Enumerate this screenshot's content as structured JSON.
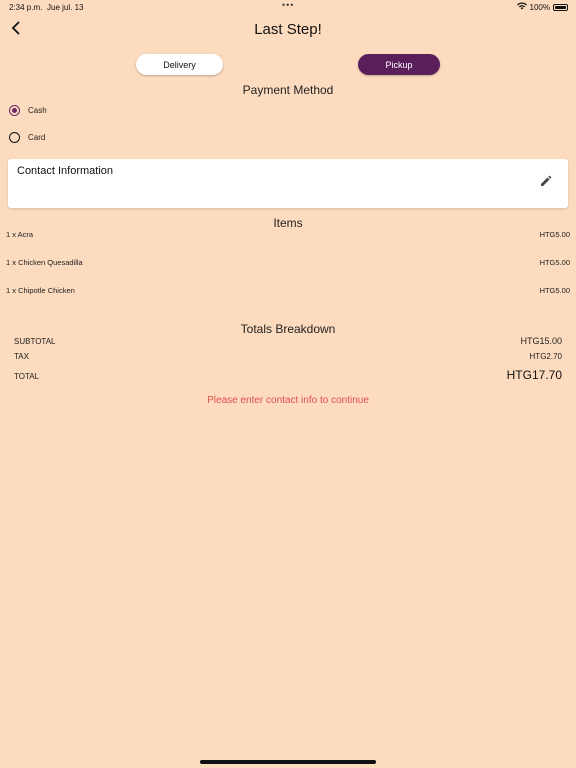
{
  "status_bar": {
    "time": "2:34 p.m.",
    "date": "Jue jul. 13",
    "dots": "•••",
    "battery": "100%"
  },
  "header": {
    "title": "Last Step!"
  },
  "order_type": {
    "delivery_label": "Delivery",
    "pickup_label": "Pickup",
    "selected": "Pickup"
  },
  "payment": {
    "title": "Payment Method",
    "options": [
      {
        "label": "Cash",
        "selected": true
      },
      {
        "label": "Card",
        "selected": false
      }
    ]
  },
  "contact": {
    "title": "Contact Information"
  },
  "items": {
    "title": "Items",
    "list": [
      {
        "name": "1 x Acra",
        "price": "HTG5.00"
      },
      {
        "name": "1 x Chicken Quesadilla",
        "price": "HTG5.00"
      },
      {
        "name": "1 x Chipotle Chicken",
        "price": "HTG5.00"
      }
    ]
  },
  "totals": {
    "title": "Totals Breakdown",
    "subtotal_label": "SUBTOTAL",
    "subtotal_value": "HTG15.00",
    "tax_label": "TAX",
    "tax_value": "HTG2.70",
    "total_label": "TOTAL",
    "total_value": "HTG17.70"
  },
  "warning": "Please enter contact info to continue",
  "colors": {
    "background": "#fddbbf",
    "accent": "#5a1e5a",
    "warning": "#e0504a"
  }
}
